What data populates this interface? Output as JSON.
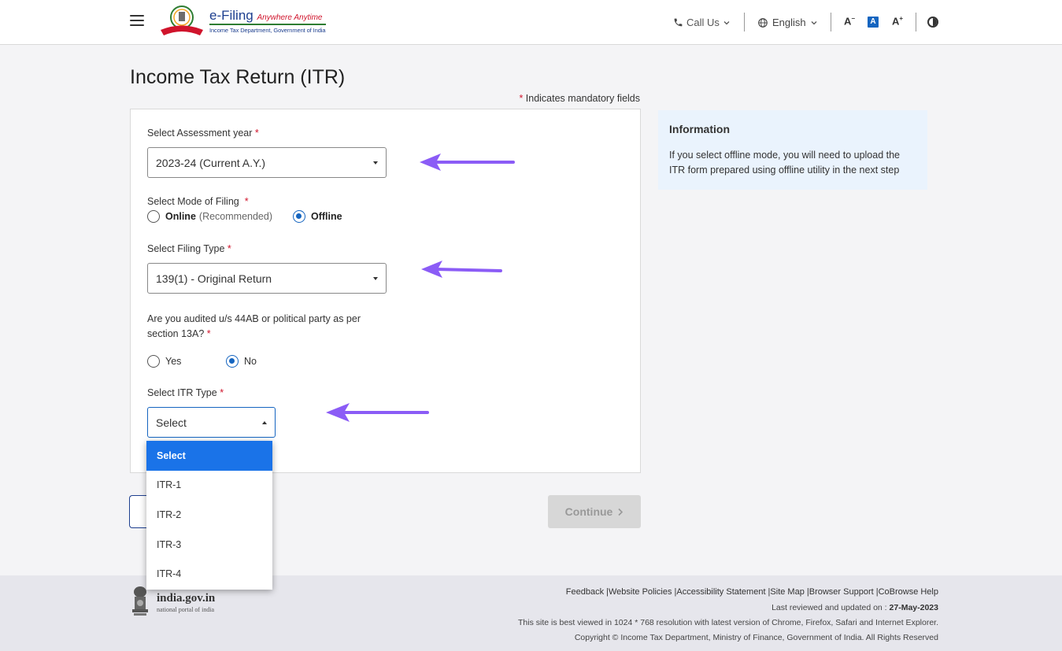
{
  "header": {
    "brand_title": "e-Filing",
    "brand_tagline": "Anywhere Anytime",
    "brand_subtitle": "Income Tax Department, Government of India",
    "call_us": "Call Us",
    "language": "English",
    "font_decrease": "A",
    "font_normal": "A",
    "font_increase": "A"
  },
  "page": {
    "title": "Income Tax Return (ITR)",
    "mandatory_note": "Indicates mandatory fields"
  },
  "form": {
    "assessment_year": {
      "label": "Select Assessment year",
      "value": "2023-24 (Current A.Y.)"
    },
    "mode_of_filing": {
      "label": "Select Mode of Filing",
      "online_label": "Online",
      "online_note": "(Recommended)",
      "offline_label": "Offline",
      "selected": "Offline"
    },
    "filing_type": {
      "label": "Select Filing Type",
      "value": "139(1) - Original Return"
    },
    "audited": {
      "label_line1": "Are you audited u/s 44AB or political party as per",
      "label_line2": "section 13A?",
      "yes_label": "Yes",
      "no_label": "No",
      "selected": "No"
    },
    "itr_type": {
      "label": "Select ITR Type",
      "value": "Select",
      "options": [
        "Select",
        "ITR-1",
        "ITR-2",
        "ITR-3",
        "ITR-4"
      ],
      "highlighted": "Select"
    }
  },
  "info": {
    "title": "Information",
    "body": "If you select offline mode, you will need to upload the ITR form prepared using offline utility in the next step"
  },
  "buttons": {
    "continue": "Continue"
  },
  "footer": {
    "portal_name": "india.gov.in",
    "portal_sub": "national portal of india",
    "links": "Feedback |Website Policies |Accessibility Statement |Site Map |Browser Support |CoBrowse Help",
    "reviewed_label": "Last reviewed and updated on :",
    "reviewed_date": "27-May-2023",
    "best_viewed": "This site is best viewed in 1024 * 768 resolution with latest version of Chrome, Firefox, Safari and Internet Explorer.",
    "copyright": "Copyright © Income Tax Department, Ministry of Finance, Government of India. All Rights Reserved"
  },
  "colors": {
    "accent_blue": "#1565c0",
    "dropdown_highlight": "#1a73e8",
    "arrow_purple": "#8b5cf6",
    "required_red": "#d0142c"
  }
}
